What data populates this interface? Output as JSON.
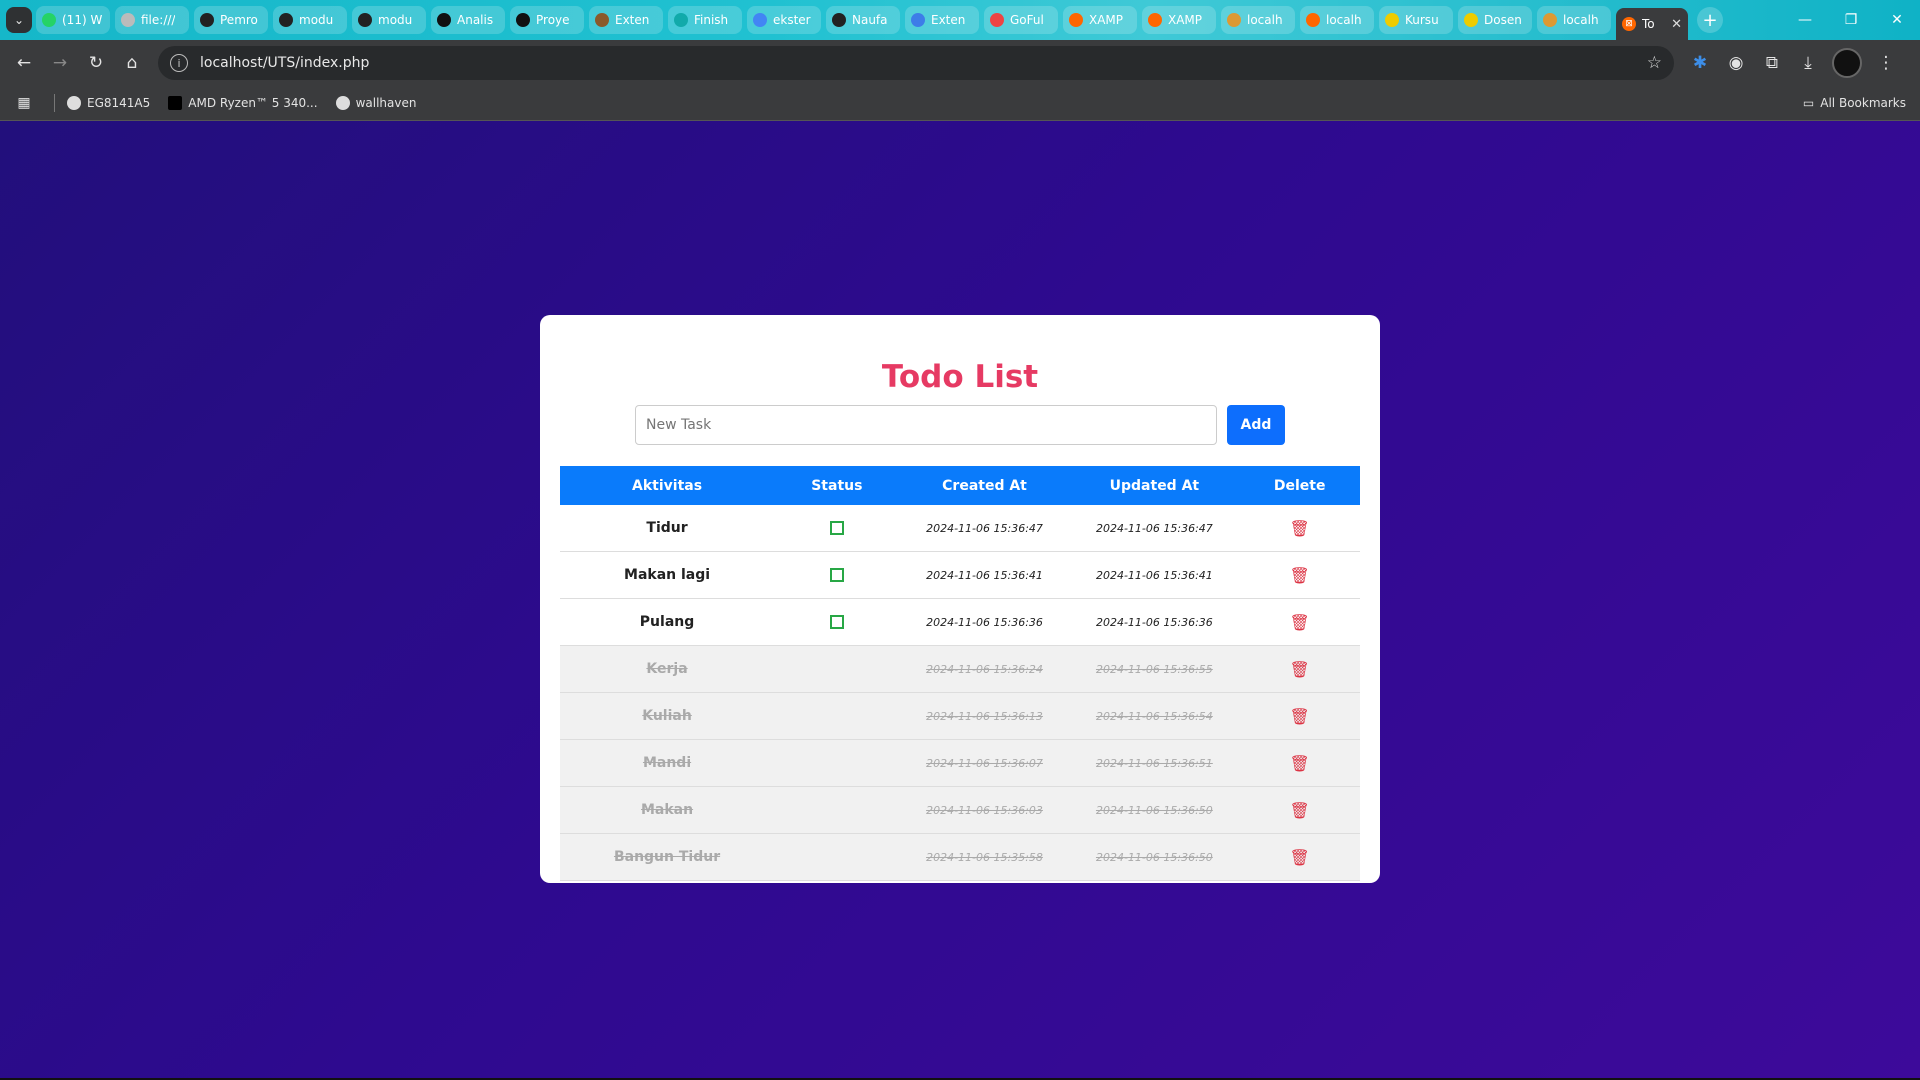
{
  "browser": {
    "tabs": [
      {
        "label": "(11) W",
        "color": "#25d366"
      },
      {
        "label": "file:///",
        "color": "#bbbbbb"
      },
      {
        "label": "Pemro",
        "color": "#222222"
      },
      {
        "label": "modu",
        "color": "#222222"
      },
      {
        "label": "modu",
        "color": "#222222"
      },
      {
        "label": "Analis",
        "color": "#111111"
      },
      {
        "label": "Proye",
        "color": "#111111"
      },
      {
        "label": "Exten",
        "color": "#8a5a2b"
      },
      {
        "label": "Finish",
        "color": "#1aa"
      },
      {
        "label": "ekster",
        "color": "#4285f4"
      },
      {
        "label": "Naufa",
        "color": "#222222"
      },
      {
        "label": "Exten",
        "color": "#3d7de8"
      },
      {
        "label": "GoFul",
        "color": "#e44"
      },
      {
        "label": "XAMP",
        "color": "#f60"
      },
      {
        "label": "XAMP",
        "color": "#f60"
      },
      {
        "label": "localh",
        "color": "#d93"
      },
      {
        "label": "localh",
        "color": "#f60"
      },
      {
        "label": "Kursu",
        "color": "#ec0"
      },
      {
        "label": "Dosen",
        "color": "#ec0"
      },
      {
        "label": "localh",
        "color": "#d93"
      }
    ],
    "active_tab": {
      "label": "To",
      "color": "#f60"
    },
    "url": "localhost/UTS/index.php",
    "bookmarks": [
      "EG8141A5",
      "AMD Ryzen™ 5 340...",
      "wallhaven"
    ],
    "all_bookmarks": "All Bookmarks"
  },
  "todo": {
    "title": "Todo List",
    "input_placeholder": "New Task",
    "add_label": "Add",
    "headers": [
      "Aktivitas",
      "Status",
      "Created At",
      "Updated At",
      "Delete"
    ],
    "rows": [
      {
        "activity": "Tidur",
        "done": false,
        "created": "2024-11-06 15:36:47",
        "updated": "2024-11-06 15:36:47"
      },
      {
        "activity": "Makan lagi",
        "done": false,
        "created": "2024-11-06 15:36:41",
        "updated": "2024-11-06 15:36:41"
      },
      {
        "activity": "Pulang",
        "done": false,
        "created": "2024-11-06 15:36:36",
        "updated": "2024-11-06 15:36:36"
      },
      {
        "activity": "Kerja",
        "done": true,
        "created": "2024-11-06 15:36:24",
        "updated": "2024-11-06 15:36:55"
      },
      {
        "activity": "Kuliah",
        "done": true,
        "created": "2024-11-06 15:36:13",
        "updated": "2024-11-06 15:36:54"
      },
      {
        "activity": "Mandi",
        "done": true,
        "created": "2024-11-06 15:36:07",
        "updated": "2024-11-06 15:36:51"
      },
      {
        "activity": "Makan",
        "done": true,
        "created": "2024-11-06 15:36:03",
        "updated": "2024-11-06 15:36:50"
      },
      {
        "activity": "Bangun Tidur",
        "done": true,
        "created": "2024-11-06 15:35:58",
        "updated": "2024-11-06 15:36:50"
      }
    ]
  },
  "colors": {
    "title": "#e63a63",
    "header": "#0a7bfb",
    "add_button": "#0d6efd",
    "delete": "#dc3545",
    "checkbox": "#28a745"
  }
}
